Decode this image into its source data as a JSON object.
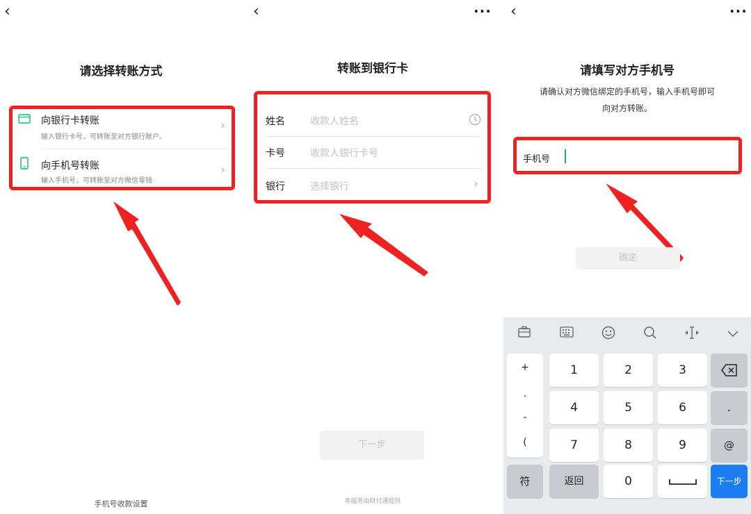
{
  "panel1": {
    "back_icon": "chevron-left-icon",
    "title": "请选择转账方式",
    "options": [
      {
        "icon": "bank-card-icon",
        "title": "向银行卡转账",
        "desc": "输入银行卡号，可转账至对方银行账户。"
      },
      {
        "icon": "phone-icon",
        "title": "向手机号转账",
        "desc": "输入手机号，可转账至对方微信零钱"
      }
    ],
    "footer": "手机号收款设置"
  },
  "panel2": {
    "back_icon": "chevron-left-icon",
    "more_icon": "more-dots-icon",
    "title": "转账到银行卡",
    "fields": [
      {
        "label": "姓名",
        "placeholder": "收款人姓名",
        "trail_icon": "clock-icon"
      },
      {
        "label": "卡号",
        "placeholder": "收款人银行卡号"
      },
      {
        "label": "银行",
        "placeholder": "选择银行",
        "trail_icon": "chevron-right-icon"
      }
    ],
    "next_button": "下一步",
    "footer": "本服务由财付通提供"
  },
  "panel3": {
    "back_icon": "chevron-left-icon",
    "more_icon": "more-dots-icon",
    "title": "请填写对方手机号",
    "desc_line1": "请确认对方微信绑定的手机号，输入手机号即可",
    "desc_line2": "向对方转账。",
    "phone_label": "手机号",
    "phone_value": "",
    "confirm_button": "确定"
  },
  "keyboard": {
    "toolbar": [
      "clipboard-icon",
      "keyboard-icon",
      "emoji-icon",
      "search-icon",
      "cursor-icon",
      "collapse-icon"
    ],
    "symbols": [
      "+",
      ".",
      "-",
      "("
    ],
    "digits": [
      "1",
      "2",
      "3",
      "4",
      "5",
      "6",
      "7",
      "8",
      "9"
    ],
    "zero": "0",
    "right_keys": [
      ".",
      "@"
    ],
    "backspace_icon": "backspace-icon",
    "sym_key": "符",
    "return_key": "返回",
    "space_icon": "space-icon",
    "next_key": "下一步"
  },
  "colors": {
    "highlight_red": "#ee2222",
    "wechat_green": "#07c160",
    "key_blue": "#1a7df2"
  }
}
